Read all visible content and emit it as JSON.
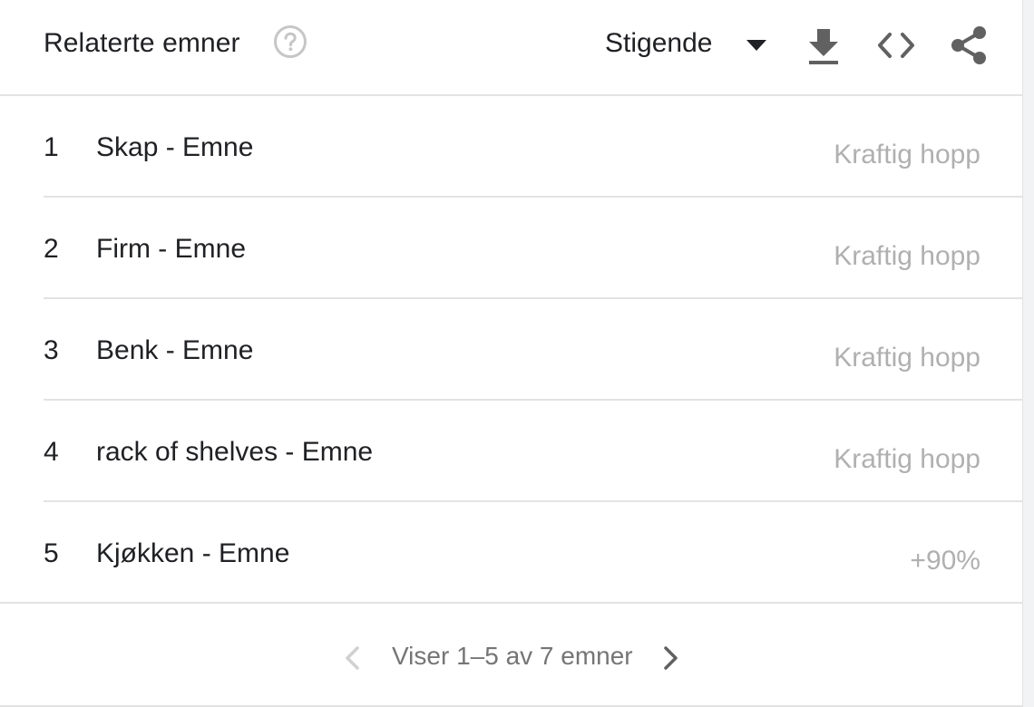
{
  "header": {
    "title": "Relaterte emner",
    "help_icon": "help-circle-icon",
    "sort": {
      "selected": "Stigende",
      "icon": "caret-down-icon"
    },
    "tools": [
      {
        "name": "download-icon"
      },
      {
        "name": "embed-code-icon"
      },
      {
        "name": "share-icon"
      }
    ]
  },
  "rows": [
    {
      "rank": "1",
      "label": "Skap - Emne",
      "value": "Kraftig hopp"
    },
    {
      "rank": "2",
      "label": "Firm - Emne",
      "value": "Kraftig hopp"
    },
    {
      "rank": "3",
      "label": "Benk - Emne",
      "value": "Kraftig hopp"
    },
    {
      "rank": "4",
      "label": "rack of shelves - Emne",
      "value": "Kraftig hopp"
    },
    {
      "rank": "5",
      "label": "Kjøkken - Emne",
      "value": "+90%"
    }
  ],
  "pager": {
    "text": "Viser 1–5 av 7 emner",
    "prev_icon": "chevron-left-icon",
    "next_icon": "chevron-right-icon"
  },
  "colors": {
    "text": "#202124",
    "muted": "#b0b0b0",
    "icon": "#616161",
    "divider": "#e3e3e3"
  }
}
